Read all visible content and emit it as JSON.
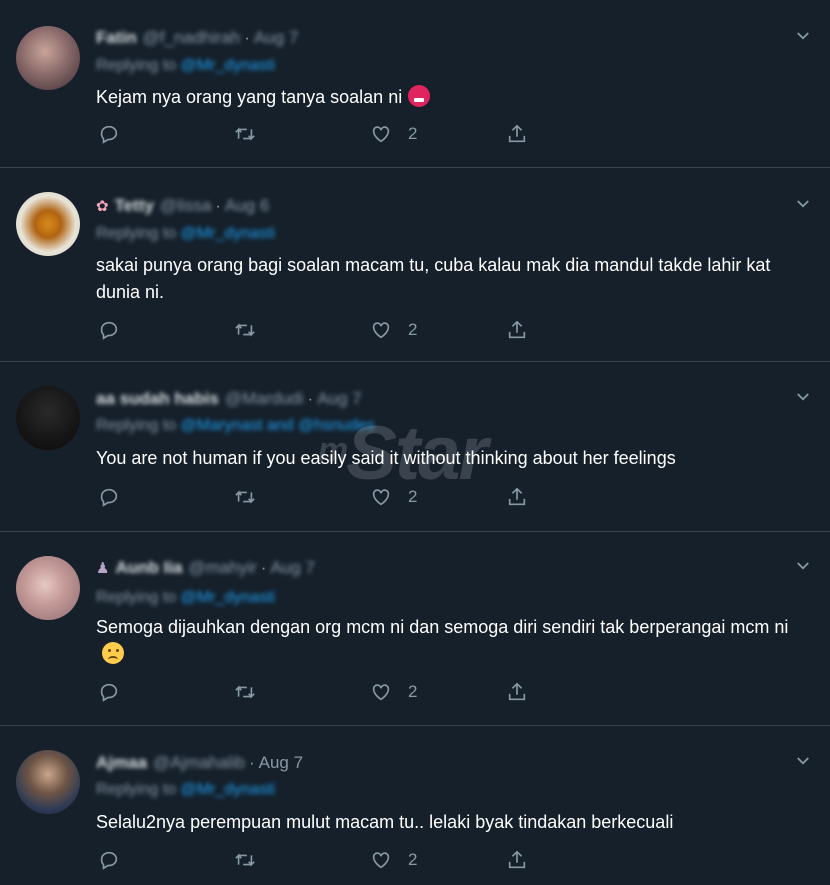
{
  "tweets": [
    {
      "name": "Fatin",
      "handle": "@f_nadhirah",
      "date": "Aug 7",
      "date_blurred": true,
      "reply_prefix": "Replying to",
      "reply_mentions": "@Mr_dynasti",
      "text": "Kejam nya orang yang tanya soalan ni",
      "emoji": "angry",
      "likes": "2"
    },
    {
      "name": "Tetty",
      "handle": "@lissa",
      "date": "Aug 6",
      "date_blurred": true,
      "reply_prefix": "Replying to",
      "reply_mentions": "@Mr_dynasti",
      "text": "sakai punya orang bagi soalan macam tu, cuba kalau mak dia mandul takde lahir kat dunia ni.",
      "emoji": "",
      "likes": "2"
    },
    {
      "name": "aa sudah habis",
      "handle": "@Mardudi",
      "date": "Aug 7",
      "date_blurred": true,
      "reply_prefix": "Replying to",
      "reply_mentions": "@Marynast and @hsnudes",
      "text": "You are not human if you easily said it without thinking about her feelings",
      "emoji": "",
      "likes": "2"
    },
    {
      "name": "Aunb Iia",
      "handle": "@mahyir",
      "date": "Aug 7",
      "date_blurred": true,
      "reply_prefix": "Replying to",
      "reply_mentions": "@Mr_dynasti",
      "text": "Semoga dijauhkan dengan org mcm ni dan semoga diri sendiri tak berperangai mcm ni",
      "emoji": "sad",
      "likes": "2"
    },
    {
      "name": "Ajmaa",
      "handle": "@Ajmahalib",
      "date": "Aug 7",
      "date_blurred": false,
      "reply_prefix": "Replying to",
      "reply_mentions": "@Mr_dynasti",
      "text": "Selalu2nya perempuan mulut macam tu.. lelaki byak tindakan berkecuali",
      "emoji": "",
      "likes": "2"
    }
  ],
  "watermark": {
    "prefix": "m",
    "text": "Star"
  },
  "colors": {
    "background": "#15202b",
    "divider": "#38444d",
    "secondary_text": "#8899a6",
    "link": "#1da1f2"
  },
  "icons": [
    "reply-icon",
    "retweet-icon",
    "like-icon",
    "share-icon",
    "chevron-down-icon"
  ]
}
